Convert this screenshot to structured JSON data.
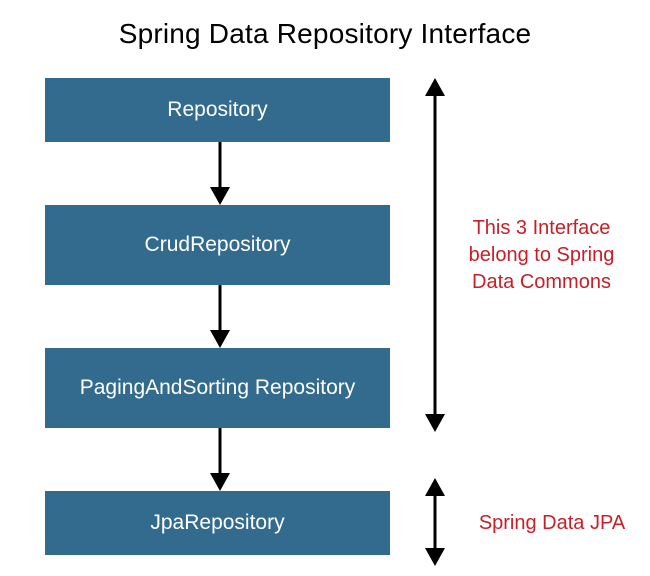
{
  "title": "Spring Data Repository Interface",
  "boxes": {
    "repository": "Repository",
    "crud": "CrudRepository",
    "paging": "PagingAndSorting Repository",
    "jpa": "JpaRepository"
  },
  "annotations": {
    "commons": "This 3 Interface belong to Spring Data Commons",
    "jpa": "Spring Data JPA"
  },
  "colors": {
    "box_bg": "#336b8f",
    "box_text": "#ffffff",
    "annotation_text": "#c62029",
    "title_text": "#000000"
  }
}
